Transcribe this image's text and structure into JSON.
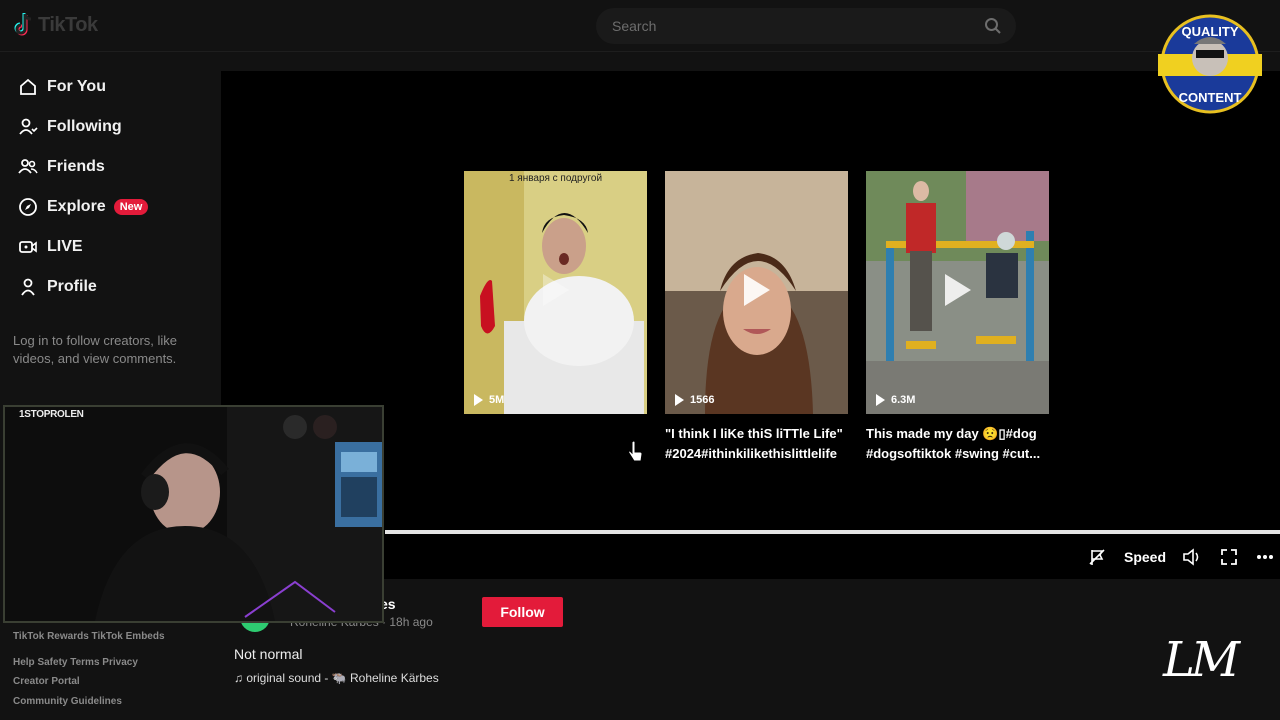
{
  "app": {
    "brand": "TikTok"
  },
  "search": {
    "placeholder": "Search"
  },
  "sidebar": {
    "items": [
      {
        "label": "For You",
        "icon": "home-icon"
      },
      {
        "label": "Following",
        "icon": "following-icon"
      },
      {
        "label": "Friends",
        "icon": "friends-icon"
      },
      {
        "label": "Explore",
        "icon": "compass-icon",
        "badge": "New"
      },
      {
        "label": "LIVE",
        "icon": "live-icon"
      },
      {
        "label": "Profile",
        "icon": "profile-icon"
      }
    ],
    "login_hint": "Log in to follow creators, like videos, and view comments.",
    "footer": {
      "row1": "TikTok Rewards  TikTok Embeds",
      "row2": "Help  Safety  Terms  Privacy",
      "row3": "Creator Portal",
      "row4": "Community Guidelines"
    }
  },
  "videos": [
    {
      "views": "5M",
      "overlay": "1 января с подругой",
      "caption": ""
    },
    {
      "views": "1566",
      "overlay": "",
      "caption": "\"I think I liKe thiS liTTle Life\" #2024#ithinkilikethislittlelife"
    },
    {
      "views": "6.3M",
      "overlay": "",
      "caption": "This made my day 😟▯#dog #dogsoftiktok #swing #cut..."
    }
  ],
  "player": {
    "speed_label": "Speed",
    "progress": 1.0
  },
  "post": {
    "author_name_partial": "es",
    "author_meta": "Roheline Kärbes · 18h ago",
    "follow_label": "Follow",
    "description": "Not normal",
    "sound": "♫ original sound -  🐃 Roheline Kärbes"
  },
  "webcam": {
    "tag": "1STOPROLEN"
  },
  "overlay_badge": {
    "top": "QUALITY",
    "bottom": "CONTENT"
  },
  "watermark": "LM",
  "colors": {
    "accent": "#e31b3a",
    "background": "#121212",
    "player_bg": "#000000"
  }
}
